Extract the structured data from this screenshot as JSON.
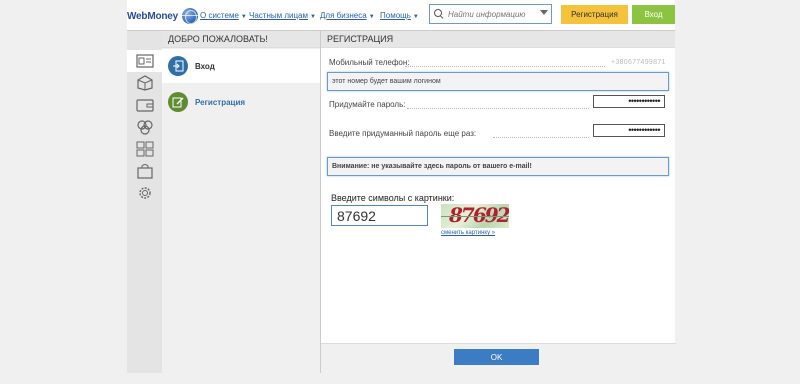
{
  "header": {
    "logo": "WebMoney",
    "nav": [
      {
        "label": "О системе"
      },
      {
        "label": "Частным лицам"
      },
      {
        "label": "Для бизнеса"
      },
      {
        "label": "Помощь"
      }
    ],
    "search_placeholder": "Найти информацию",
    "register_label": "Регистрация",
    "login_label": "Вход"
  },
  "left": {
    "title": "ДОБРО ПОЖАЛОВАТЬ!",
    "items": [
      {
        "label": "Вход"
      },
      {
        "label": "Регистрация"
      }
    ]
  },
  "form": {
    "title": "РЕГИСТРАЦИЯ",
    "phone_label": "Мобильный телефон:",
    "phone_value": "+380677499871",
    "phone_hint": "этот номер будет вашим логином",
    "password_label": "Придумайте пароль:",
    "password_value": "••••••••••••",
    "password_repeat_label": "Введите придуманный пароль еще раз:",
    "password_repeat_value": "••••••••••••",
    "warning": "Внимание: не указывайте здесь пароль от вашего e-mail!",
    "captcha_label": "Введите символы с картинки:",
    "captcha_value": "87692",
    "captcha_image_text": "87692",
    "captcha_change": "сменить картинку »",
    "ok_label": "OK"
  },
  "colors": {
    "accent_blue": "#3b7cc4",
    "register_yellow": "#f5c23c",
    "login_green": "#8cc341"
  }
}
